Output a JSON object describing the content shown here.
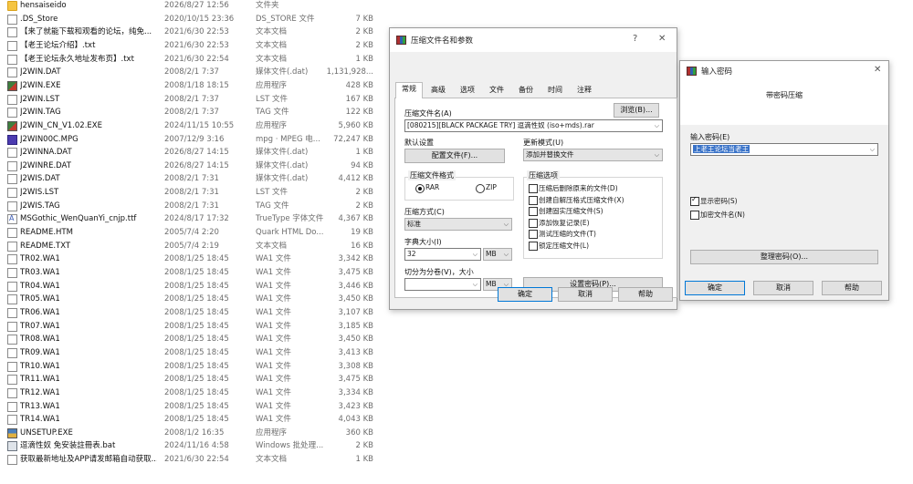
{
  "files": [
    {
      "name": "hensaiseido",
      "date": "2026/8/27 12:56",
      "type": "文件夹",
      "size": "",
      "icon": "folder"
    },
    {
      "name": ".DS_Store",
      "date": "2020/10/15 23:36",
      "type": "DS_STORE 文件",
      "size": "7 KB",
      "icon": "doc"
    },
    {
      "name": "【来了就能下载和观看的论坛，纯免...",
      "date": "2021/6/30 22:53",
      "type": "文本文档",
      "size": "2 KB",
      "icon": "doc"
    },
    {
      "name": "【老王论坛介绍】.txt",
      "date": "2021/6/30 22:53",
      "type": "文本文档",
      "size": "2 KB",
      "icon": "doc"
    },
    {
      "name": "【老王论坛永久地址发布页】.txt",
      "date": "2021/6/30 22:54",
      "type": "文本文档",
      "size": "1 KB",
      "icon": "doc"
    },
    {
      "name": "J2WIN.DAT",
      "date": "2008/2/1 7:37",
      "type": "媒体文件(.dat)",
      "size": "1,131,928...",
      "icon": "doc"
    },
    {
      "name": "J2WIN.EXE",
      "date": "2008/1/18 18:15",
      "type": "应用程序",
      "size": "428 KB",
      "icon": "app"
    },
    {
      "name": "J2WIN.LST",
      "date": "2008/2/1 7:37",
      "type": "LST 文件",
      "size": "167 KB",
      "icon": "doc"
    },
    {
      "name": "J2WIN.TAG",
      "date": "2008/2/1 7:37",
      "type": "TAG 文件",
      "size": "122 KB",
      "icon": "doc"
    },
    {
      "name": "J2WIN_CN_V1.02.EXE",
      "date": "2024/11/15 10:55",
      "type": "应用程序",
      "size": "5,960 KB",
      "icon": "app"
    },
    {
      "name": "J2WIN00C.MPG",
      "date": "2007/12/9 3:16",
      "type": "mpg · MPEG 电...",
      "size": "72,247 KB",
      "icon": "media"
    },
    {
      "name": "J2WINNA.DAT",
      "date": "2026/8/27 14:15",
      "type": "媒体文件(.dat)",
      "size": "1 KB",
      "icon": "doc"
    },
    {
      "name": "J2WINRE.DAT",
      "date": "2026/8/27 14:15",
      "type": "媒体文件(.dat)",
      "size": "94 KB",
      "icon": "doc"
    },
    {
      "name": "J2WIS.DAT",
      "date": "2008/2/1 7:31",
      "type": "媒体文件(.dat)",
      "size": "4,412 KB",
      "icon": "doc"
    },
    {
      "name": "J2WIS.LST",
      "date": "2008/2/1 7:31",
      "type": "LST 文件",
      "size": "2 KB",
      "icon": "doc"
    },
    {
      "name": "J2WIS.TAG",
      "date": "2008/2/1 7:31",
      "type": "TAG 文件",
      "size": "2 KB",
      "icon": "doc"
    },
    {
      "name": "MSGothic_WenQuanYi_cnjp.ttf",
      "date": "2024/8/17 17:32",
      "type": "TrueType 字体文件",
      "size": "4,367 KB",
      "icon": "font"
    },
    {
      "name": "README.HTM",
      "date": "2005/7/4 2:20",
      "type": "Quark HTML Do...",
      "size": "19 KB",
      "icon": "doc"
    },
    {
      "name": "README.TXT",
      "date": "2005/7/4 2:19",
      "type": "文本文档",
      "size": "16 KB",
      "icon": "doc"
    },
    {
      "name": "TR02.WA1",
      "date": "2008/1/25 18:45",
      "type": "WA1 文件",
      "size": "3,342 KB",
      "icon": "doc"
    },
    {
      "name": "TR03.WA1",
      "date": "2008/1/25 18:45",
      "type": "WA1 文件",
      "size": "3,475 KB",
      "icon": "doc"
    },
    {
      "name": "TR04.WA1",
      "date": "2008/1/25 18:45",
      "type": "WA1 文件",
      "size": "3,446 KB",
      "icon": "doc"
    },
    {
      "name": "TR05.WA1",
      "date": "2008/1/25 18:45",
      "type": "WA1 文件",
      "size": "3,450 KB",
      "icon": "doc"
    },
    {
      "name": "TR06.WA1",
      "date": "2008/1/25 18:45",
      "type": "WA1 文件",
      "size": "3,107 KB",
      "icon": "doc"
    },
    {
      "name": "TR07.WA1",
      "date": "2008/1/25 18:45",
      "type": "WA1 文件",
      "size": "3,185 KB",
      "icon": "doc"
    },
    {
      "name": "TR08.WA1",
      "date": "2008/1/25 18:45",
      "type": "WA1 文件",
      "size": "3,450 KB",
      "icon": "doc"
    },
    {
      "name": "TR09.WA1",
      "date": "2008/1/25 18:45",
      "type": "WA1 文件",
      "size": "3,413 KB",
      "icon": "doc"
    },
    {
      "name": "TR10.WA1",
      "date": "2008/1/25 18:45",
      "type": "WA1 文件",
      "size": "3,308 KB",
      "icon": "doc"
    },
    {
      "name": "TR11.WA1",
      "date": "2008/1/25 18:45",
      "type": "WA1 文件",
      "size": "3,475 KB",
      "icon": "doc"
    },
    {
      "name": "TR12.WA1",
      "date": "2008/1/25 18:45",
      "type": "WA1 文件",
      "size": "3,334 KB",
      "icon": "doc"
    },
    {
      "name": "TR13.WA1",
      "date": "2008/1/25 18:45",
      "type": "WA1 文件",
      "size": "3,423 KB",
      "icon": "doc"
    },
    {
      "name": "TR14.WA1",
      "date": "2008/1/25 18:45",
      "type": "WA1 文件",
      "size": "4,043 KB",
      "icon": "doc"
    },
    {
      "name": "UNSETUP.EXE",
      "date": "2008/1/2 16:35",
      "type": "应用程序",
      "size": "360 KB",
      "icon": "setup"
    },
    {
      "name": "逗滴性奴 免安装註冊表.bat",
      "date": "2024/11/16 4:58",
      "type": "Windows 批处理...",
      "size": "2 KB",
      "icon": "batch"
    },
    {
      "name": "获取最新地址及APP请发邮箱自动获取...",
      "date": "2021/6/30 22:54",
      "type": "文本文档",
      "size": "1 KB",
      "icon": "doc"
    }
  ],
  "archive_dialog": {
    "title": "压缩文件名和参数",
    "help_btn": "?",
    "close_btn": "✕",
    "tabs": [
      "常规",
      "高级",
      "选项",
      "文件",
      "备份",
      "时间",
      "注释"
    ],
    "filename_label": "压缩文件名(A)",
    "browse_btn": "浏览(B)...",
    "filename_value": "[080215][BLACK PACKAGE TRY] 逗滴性奴 (iso+mds).rar",
    "default_settings_label": "默认设置",
    "profiles_btn": "配置文件(F)...",
    "update_mode_label": "更新模式(U)",
    "update_mode_value": "添加并替换文件",
    "format_group": "压缩文件格式",
    "format_rar": "RAR",
    "format_zip": "ZIP",
    "options_group": "压缩选项",
    "options": [
      "压缩后删除原来的文件(D)",
      "创建自解压格式压缩文件(X)",
      "创建固实压缩文件(S)",
      "添加恢复记录(E)",
      "测试压缩的文件(T)",
      "锁定压缩文件(L)"
    ],
    "method_label": "压缩方式(C)",
    "method_value": "标准",
    "dict_label": "字典大小(I)",
    "dict_value": "32",
    "dict_unit": "MB",
    "split_label": "切分为分卷(V)，大小",
    "split_unit": "MB",
    "set_password_btn": "设置密码(P)...",
    "ok_btn": "确定",
    "cancel_btn": "取消",
    "help_btn_bottom": "帮助"
  },
  "password_dialog": {
    "title": "输入密码",
    "close_btn": "✕",
    "heading": "带密码压缩",
    "password_label": "输入密码(E)",
    "password_value": "上老王论坛当老王",
    "show_password": "显示密码(S)",
    "encrypt_names": "加密文件名(N)",
    "organize_btn": "整理密码(O)...",
    "ok_btn": "确定",
    "cancel_btn": "取消",
    "help_btn": "帮助"
  }
}
